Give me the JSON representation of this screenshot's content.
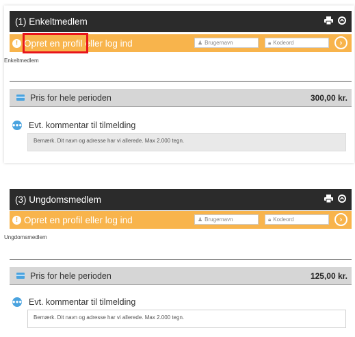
{
  "cards": [
    {
      "title": "(1) Enkeltmedlem",
      "login": {
        "create_profile": "Opret en profil",
        "or_login": "eller log ind"
      },
      "username_placeholder": "Brugernavn",
      "password_placeholder": "Kodeord",
      "member_type": "Enkeltmedlem",
      "price_label": "Pris for hele perioden",
      "price_value": "300,00 kr.",
      "comment_label": "Evt. kommentar til tilmelding",
      "comment_placeholder": "Bemærk. Dit navn og adresse har vi allerede. Max 2.000 tegn."
    },
    {
      "title": "(3) Ungdomsmedlem",
      "login": {
        "create_profile": "Opret en profil",
        "or_login": "eller log ind"
      },
      "username_placeholder": "Brugernavn",
      "password_placeholder": "Kodeord",
      "member_type": "Ungdomsmedlem",
      "price_label": "Pris for hele perioden",
      "price_value": "125,00 kr.",
      "comment_label": "Evt. kommentar til tilmelding",
      "comment_placeholder": "Bemærk. Dit navn og adresse har vi allerede. Max 2.000 tegn."
    }
  ],
  "icons": {
    "print": "print-icon",
    "collapse": "circle-arrow-up-icon",
    "go": "circle-arrow-right-icon",
    "info": "info-icon",
    "user": "user-icon",
    "lock": "lock-icon",
    "card": "credit-card-icon",
    "comment": "comment-icon"
  },
  "colors": {
    "accent": "#f8b44c",
    "header": "#2b2b2b",
    "price_bar": "#d6d6d6",
    "blue_icon": "#4aa3df",
    "highlight": "#e8141b"
  }
}
